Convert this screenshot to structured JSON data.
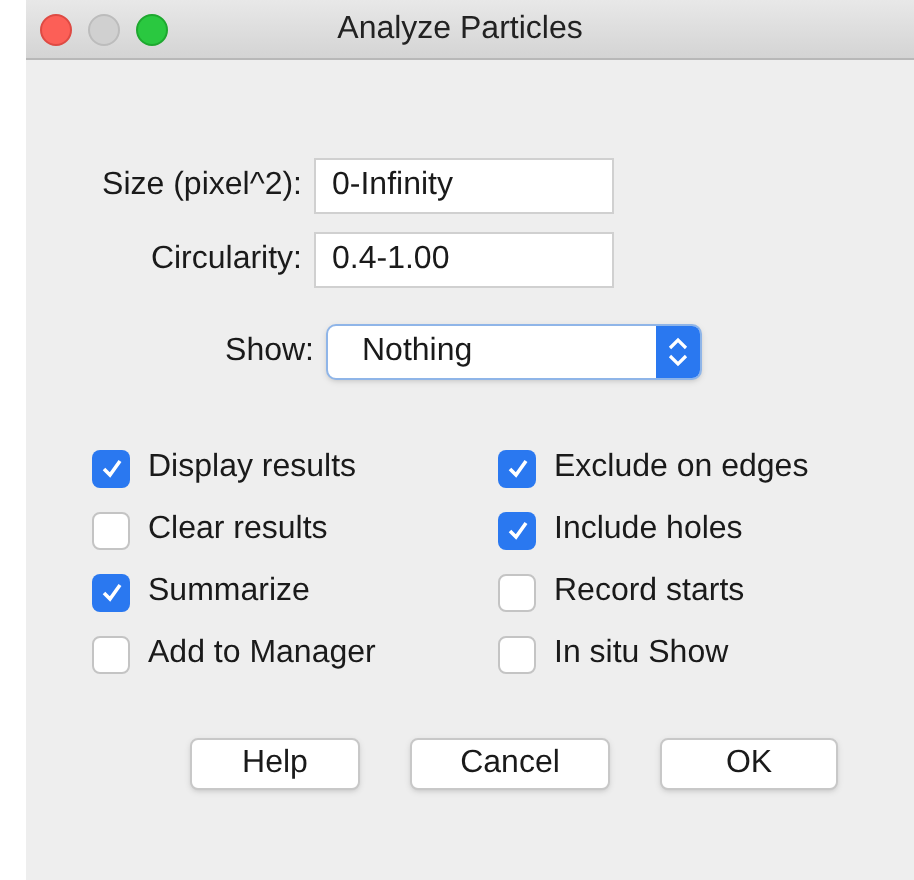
{
  "window": {
    "title": "Analyze Particles"
  },
  "fields": [
    {
      "label": "Size (pixel^2):",
      "value": "0-Infinity"
    },
    {
      "label": "Circularity:",
      "value": "0.4-1.00"
    }
  ],
  "show": {
    "label": "Show:",
    "value": "Nothing"
  },
  "checkboxes": [
    {
      "label": "Display results",
      "checked": true
    },
    {
      "label": "Exclude on edges",
      "checked": true
    },
    {
      "label": "Clear results",
      "checked": false
    },
    {
      "label": "Include holes",
      "checked": true
    },
    {
      "label": "Summarize",
      "checked": true
    },
    {
      "label": "Record starts",
      "checked": false
    },
    {
      "label": "Add to Manager",
      "checked": false
    },
    {
      "label": "In situ Show",
      "checked": false
    }
  ],
  "buttons": [
    "Help",
    "Cancel",
    "OK"
  ]
}
